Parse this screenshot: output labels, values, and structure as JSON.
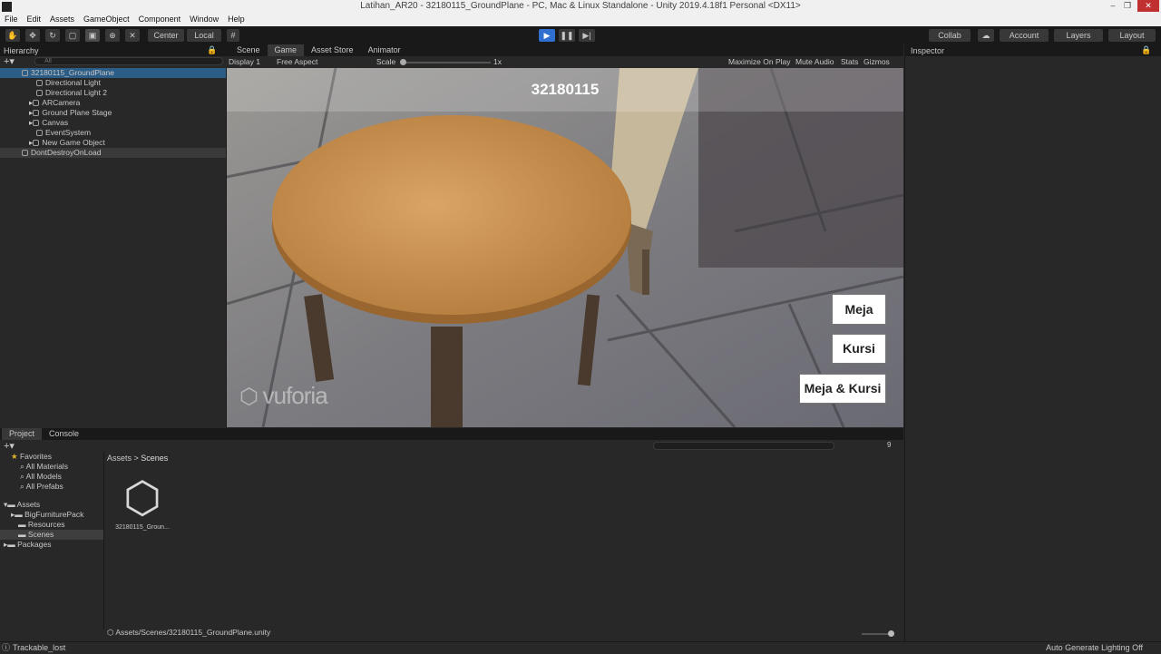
{
  "window": {
    "title": "Latihan_AR20 - 32180115_GroundPlane - PC, Mac & Linux Standalone - Unity 2019.4.18f1 Personal <DX11>",
    "controls": [
      "–",
      "❐",
      "✕"
    ]
  },
  "menu": [
    "File",
    "Edit",
    "Assets",
    "GameObject",
    "Component",
    "Window",
    "Help"
  ],
  "toolbar": {
    "pivot": "Center",
    "space": "Local",
    "collab": "Collab",
    "account": "Account",
    "layers": "Layers",
    "layout": "Layout"
  },
  "hierarchy": {
    "tab": "Hierarchy",
    "search_placeholder": "All",
    "scene": "32180115_GroundPlane",
    "items": [
      "Directional Light",
      "Directional Light 2",
      "ARCamera",
      "Ground Plane Stage",
      "Canvas",
      "EventSystem",
      "New Game Object"
    ],
    "dont_destroy": "DontDestroyOnLoad"
  },
  "gameview": {
    "tabs": [
      "Scene",
      "Game",
      "Asset Store",
      "Animator"
    ],
    "display": "Display 1",
    "aspect": "Free Aspect",
    "scale_label": "Scale",
    "scale_value": "1x",
    "options": [
      "Maximize On Play",
      "Mute Audio",
      "Stats",
      "Gizmos"
    ],
    "overlay_title": "32180115",
    "watermark": "vuforia",
    "buttons": [
      "Meja",
      "Kursi",
      "Meja & Kursi"
    ]
  },
  "inspector": {
    "tab": "Inspector"
  },
  "project": {
    "tabs": [
      "Project",
      "Console"
    ],
    "favorites_label": "Favorites",
    "favorites": [
      "All Materials",
      "All Models",
      "All Prefabs"
    ],
    "assets_label": "Assets",
    "asset_folders": [
      "BigFurniturePack",
      "Resources",
      "Scenes"
    ],
    "packages_label": "Packages",
    "breadcrumb": [
      "Assets",
      "Scenes"
    ],
    "file_name": "32180115_Groun...",
    "path": "Assets/Scenes/32180115_GroundPlane.unity",
    "hidden_count": "9"
  },
  "status": {
    "message": "Trackable_lost",
    "lighting": "Auto Generate Lighting Off"
  }
}
